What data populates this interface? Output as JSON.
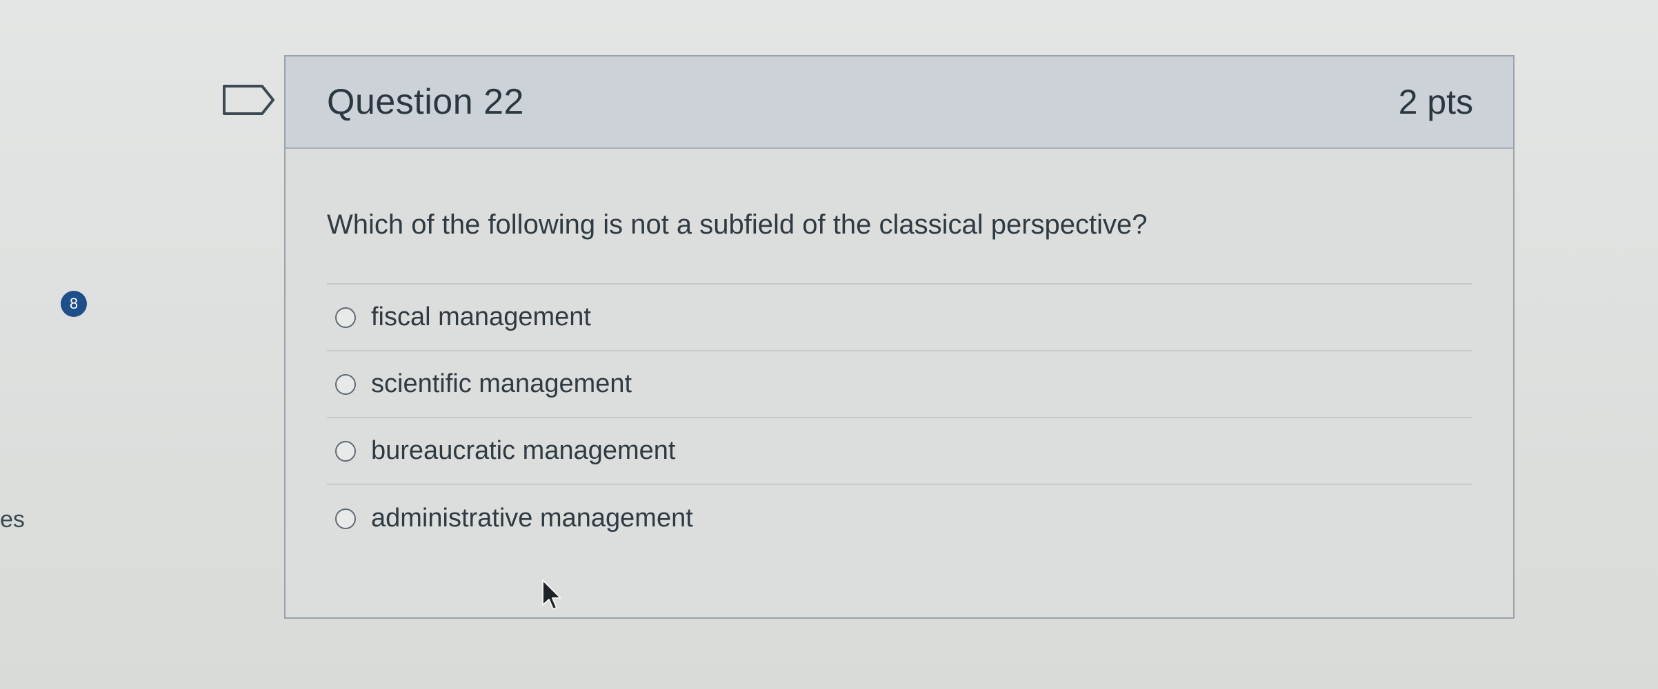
{
  "side": {
    "fragment_text": "es",
    "badge_number": "8"
  },
  "question": {
    "title": "Question 22",
    "points": "2 pts",
    "text": "Which of the following is not a subfield of the classical perspective?",
    "answers": [
      {
        "label": "fiscal management"
      },
      {
        "label": "scientific management"
      },
      {
        "label": "bureaucratic management"
      },
      {
        "label": "administrative management"
      }
    ]
  },
  "icons": {
    "flag": "flag-icon",
    "cursor": "mouse-pointer-icon"
  }
}
